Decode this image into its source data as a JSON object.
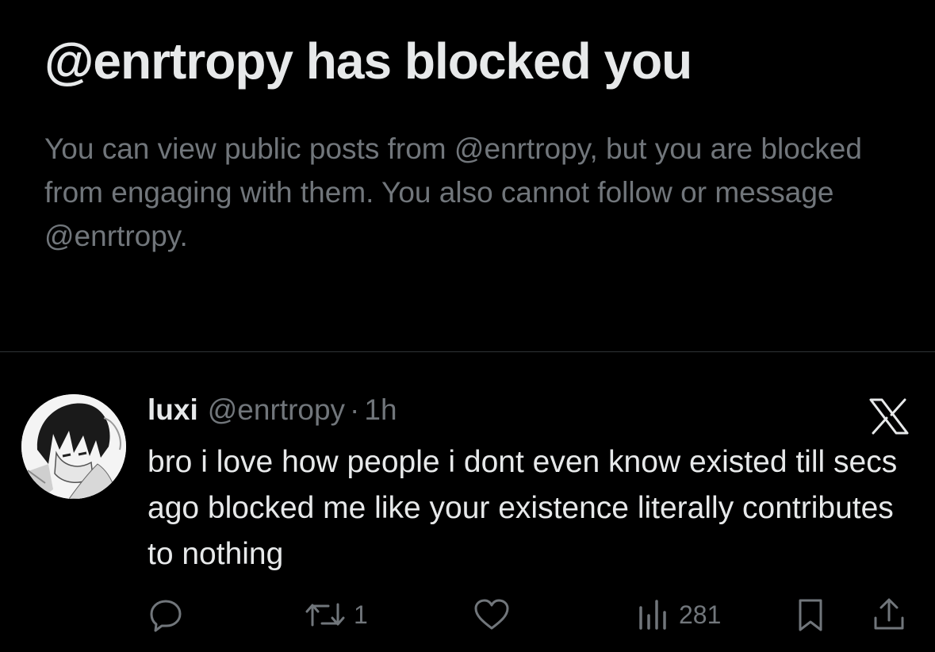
{
  "blocked": {
    "title": "@enrtropy has blocked you",
    "description": "You can view public posts from @enrtropy, but you are blocked from engaging with them. You also cannot follow or message @enrtropy."
  },
  "post": {
    "display_name": "luxi",
    "handle": "@enrtropy",
    "separator": "·",
    "time": "1h",
    "text": "bro i love how people i dont even know existed till secs ago blocked me like your existence literally contributes to nothing",
    "avatar_icon": "avatar-anime-sketch",
    "close_icon": "x-logo-icon",
    "actions": {
      "reply_icon": "reply-icon",
      "repost_icon": "repost-icon",
      "repost_count": "1",
      "like_icon": "heart-icon",
      "views_icon": "views-bar-chart-icon",
      "views_count": "281",
      "bookmark_icon": "bookmark-icon",
      "share_icon": "share-icon"
    }
  },
  "colors": {
    "background": "#000000",
    "primary_text": "#e7e9ea",
    "secondary_text": "#71767b",
    "divider": "#2f3336"
  }
}
